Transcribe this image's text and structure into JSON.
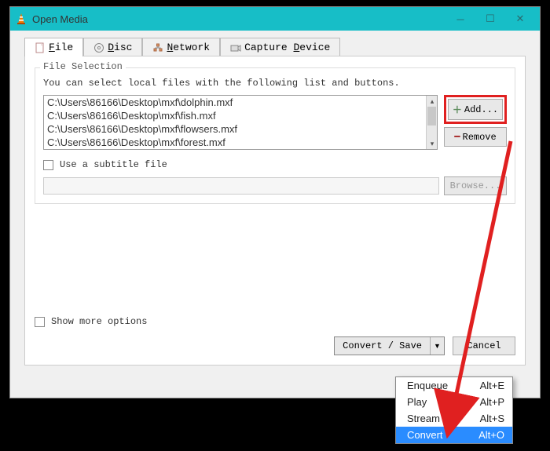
{
  "window": {
    "title": "Open Media"
  },
  "tabs": {
    "file": "File",
    "disc": "Disc",
    "network": "Network",
    "capture": "Capture Device"
  },
  "file_selection": {
    "legend": "File Selection",
    "hint": "You can select local files with the following list and buttons.",
    "files": [
      "C:\\Users\\86166\\Desktop\\mxf\\dolphin.mxf",
      "C:\\Users\\86166\\Desktop\\mxf\\fish.mxf",
      "C:\\Users\\86166\\Desktop\\mxf\\flowsers.mxf",
      "C:\\Users\\86166\\Desktop\\mxf\\forest.mxf"
    ],
    "add_label": "Add...",
    "remove_label": "Remove"
  },
  "subtitle": {
    "label": "Use a subtitle file",
    "browse_label": "Browse..."
  },
  "show_more_label": "Show more options",
  "buttons": {
    "convert_save": "Convert / Save",
    "cancel": "Cancel"
  },
  "menu": {
    "items": [
      {
        "label": "Enqueue",
        "shortcut": "Alt+E"
      },
      {
        "label": "Play",
        "shortcut": "Alt+P"
      },
      {
        "label": "Stream",
        "shortcut": "Alt+S"
      },
      {
        "label": "Convert",
        "shortcut": "Alt+O"
      }
    ],
    "selected_index": 3
  }
}
